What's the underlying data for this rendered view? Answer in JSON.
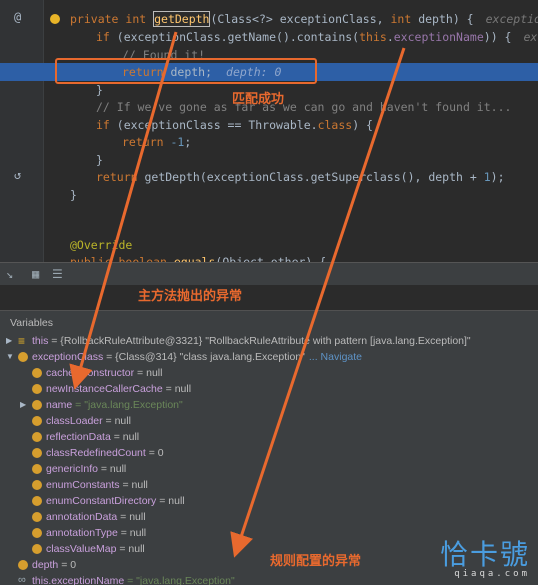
{
  "editor": {
    "lines": [
      {
        "k": "sig",
        "parts": [
          [
            "kw",
            "private "
          ],
          [
            "kw",
            "int "
          ],
          [
            "fn",
            "getDepth"
          ],
          [
            "",
            "(Class<?> exceptionClass, "
          ],
          [
            "kw",
            "int "
          ],
          [
            "",
            "depth) {"
          ]
        ],
        "hint": "exceptionClass"
      },
      {
        "k": "if1",
        "parts": [
          [
            "kw",
            "if "
          ],
          [
            "",
            "(exceptionClass.getName().contains("
          ],
          [
            "kw",
            "this"
          ],
          [
            "",
            "."
          ],
          [
            "fld",
            "exceptionName"
          ],
          [
            "",
            ")) {"
          ]
        ],
        "hint": "exception"
      },
      {
        "k": "cm1",
        "parts": [
          [
            "cm",
            "// Found it!"
          ]
        ]
      },
      {
        "k": "ret1",
        "parts": [
          [
            "kw",
            "return "
          ],
          [
            "",
            "depth;"
          ]
        ],
        "inline": "depth: 0"
      },
      {
        "k": "close1",
        "parts": [
          [
            "",
            "}"
          ]
        ]
      },
      {
        "k": "cm2",
        "parts": [
          [
            "cm",
            "// If we've gone as far as we can go and haven't found it..."
          ]
        ]
      },
      {
        "k": "if2",
        "parts": [
          [
            "kw",
            "if "
          ],
          [
            "",
            "(exceptionClass == Throwable."
          ],
          [
            "kw",
            "class"
          ],
          [
            "",
            ") {"
          ]
        ]
      },
      {
        "k": "ret2",
        "parts": [
          [
            "kw",
            "return "
          ],
          [
            "num",
            "-1"
          ],
          [
            "",
            ";"
          ]
        ]
      },
      {
        "k": "close2",
        "parts": [
          [
            "",
            "}"
          ]
        ]
      },
      {
        "k": "ret3",
        "parts": [
          [
            "kw",
            "return "
          ],
          [
            "",
            "getDepth(exceptionClass.getSuperclass(), depth + "
          ],
          [
            "num",
            "1"
          ],
          [
            "",
            ");"
          ]
        ]
      },
      {
        "k": "close3",
        "parts": [
          [
            "",
            "}"
          ]
        ]
      },
      {
        "k": "ann",
        "parts": [
          [
            "ann",
            "@Override"
          ]
        ]
      },
      {
        "k": "eq",
        "parts": [
          [
            "kw",
            "public "
          ],
          [
            "kw",
            "boolean "
          ],
          [
            "fn",
            "equals"
          ],
          [
            "",
            "(Object other) {"
          ]
        ]
      }
    ]
  },
  "debugger": {
    "variables_title": "Variables",
    "rows": [
      {
        "name": "this",
        "value": " = {RollbackRuleAttribute@3321} \"RollbackRuleAttribute with pattern [java.lang.Exception]\"",
        "icon": "list",
        "exp": "collapsed",
        "depth": 0
      },
      {
        "name": "exceptionClass",
        "value": " = {Class@314} \"class java.lang.Exception\"",
        "nav": "... Navigate",
        "icon": "orange",
        "exp": "expanded",
        "depth": 0
      },
      {
        "name": "cachedConstructor",
        "value": " = null",
        "icon": "orange",
        "depth": 1
      },
      {
        "name": "newInstanceCallerCache",
        "value": " = null",
        "icon": "orange",
        "depth": 1
      },
      {
        "name": "name",
        "value": " = \"java.lang.Exception\"",
        "icon": "orange",
        "exp": "collapsed",
        "depth": 1,
        "str": true
      },
      {
        "name": "classLoader",
        "value": " = null",
        "icon": "orange",
        "depth": 1
      },
      {
        "name": "reflectionData",
        "value": " = null",
        "icon": "orange",
        "depth": 1
      },
      {
        "name": "classRedefinedCount",
        "value": " = 0",
        "icon": "orange",
        "depth": 1
      },
      {
        "name": "genericInfo",
        "value": " = null",
        "icon": "orange",
        "depth": 1
      },
      {
        "name": "enumConstants",
        "value": " = null",
        "icon": "orange",
        "depth": 1
      },
      {
        "name": "enumConstantDirectory",
        "value": " = null",
        "icon": "orange",
        "depth": 1
      },
      {
        "name": "annotationData",
        "value": " = null",
        "icon": "orange",
        "depth": 1
      },
      {
        "name": "annotationType",
        "value": " = null",
        "icon": "orange",
        "depth": 1
      },
      {
        "name": "classValueMap",
        "value": " = null",
        "icon": "orange",
        "depth": 1
      },
      {
        "name": "depth",
        "value": " = 0",
        "icon": "orange",
        "depth": 0
      },
      {
        "name": "this.exceptionName",
        "value": " = \"java.lang.Exception\"",
        "icon": "infinity",
        "depth": 0,
        "str": true
      }
    ]
  },
  "annotations": {
    "match_success": "匹配成功",
    "main_exception": "主方法抛出的异常",
    "rule_exception": "规则配置的异常"
  },
  "watermark": {
    "logo": "恰卡號",
    "url": "qiaqa.com"
  },
  "colors": {
    "accent": "#e8692e",
    "selection": "#2d5fa6",
    "background": "#2b2b2b"
  }
}
